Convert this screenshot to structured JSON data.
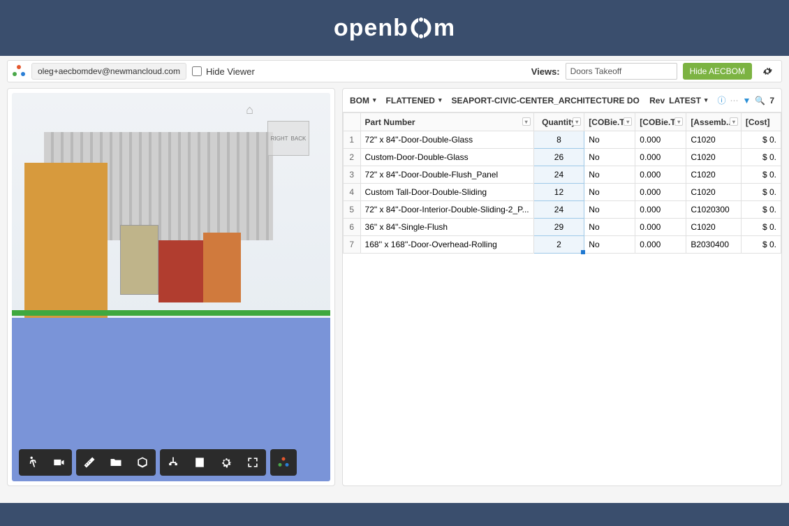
{
  "banner": {
    "brand_left": "openb",
    "brand_right": "m"
  },
  "topbar": {
    "email": "oleg+aecbomdev@newmancloud.com",
    "hide_viewer_label": "Hide Viewer",
    "views_label": "Views:",
    "views_selected": "Doors Takeoff",
    "hide_aecbom_label": "Hide AECBOM"
  },
  "viewer": {
    "navcube_right": "RIGHT",
    "navcube_back": "BACK"
  },
  "bom_header": {
    "bom_label": "BOM",
    "flattened_label": "FLATTENED",
    "title": "SEAPORT-CIVIC-CENTER_ARCHITECTURE DOORS TAKEOFF",
    "rev_label": "Rev",
    "rev_value": "LATEST",
    "count": "7"
  },
  "columns": {
    "part_number": "Part Number",
    "quantity": "Quantity",
    "cobie_t1": "[COBie.T...",
    "cobie_t2": "[COBie.T...",
    "assemb": "[Assemb...",
    "cost": "[Cost]"
  },
  "rows": [
    {
      "n": "1",
      "part": "72\" x 84\"-Door-Double-Glass",
      "qty": "8",
      "cob1": "No",
      "cob2": "0.000",
      "asm": "C1020",
      "cost": "$ 0."
    },
    {
      "n": "2",
      "part": "Custom-Door-Double-Glass",
      "qty": "26",
      "cob1": "No",
      "cob2": "0.000",
      "asm": "C1020",
      "cost": "$ 0."
    },
    {
      "n": "3",
      "part": "72\" x 84\"-Door-Double-Flush_Panel",
      "qty": "24",
      "cob1": "No",
      "cob2": "0.000",
      "asm": "C1020",
      "cost": "$ 0."
    },
    {
      "n": "4",
      "part": "Custom Tall-Door-Double-Sliding",
      "qty": "12",
      "cob1": "No",
      "cob2": "0.000",
      "asm": "C1020",
      "cost": "$ 0."
    },
    {
      "n": "5",
      "part": "72\" x 84\"-Door-Interior-Double-Sliding-2_P...",
      "qty": "24",
      "cob1": "No",
      "cob2": "0.000",
      "asm": "C1020300",
      "cost": "$ 0."
    },
    {
      "n": "6",
      "part": "36\" x 84\"-Single-Flush",
      "qty": "29",
      "cob1": "No",
      "cob2": "0.000",
      "asm": "C1020",
      "cost": "$ 0."
    },
    {
      "n": "7",
      "part": "168'' x 168''-Door-Overhead-Rolling",
      "qty": "2",
      "cob1": "No",
      "cob2": "0.000",
      "asm": "B2030400",
      "cost": "$ 0."
    }
  ]
}
